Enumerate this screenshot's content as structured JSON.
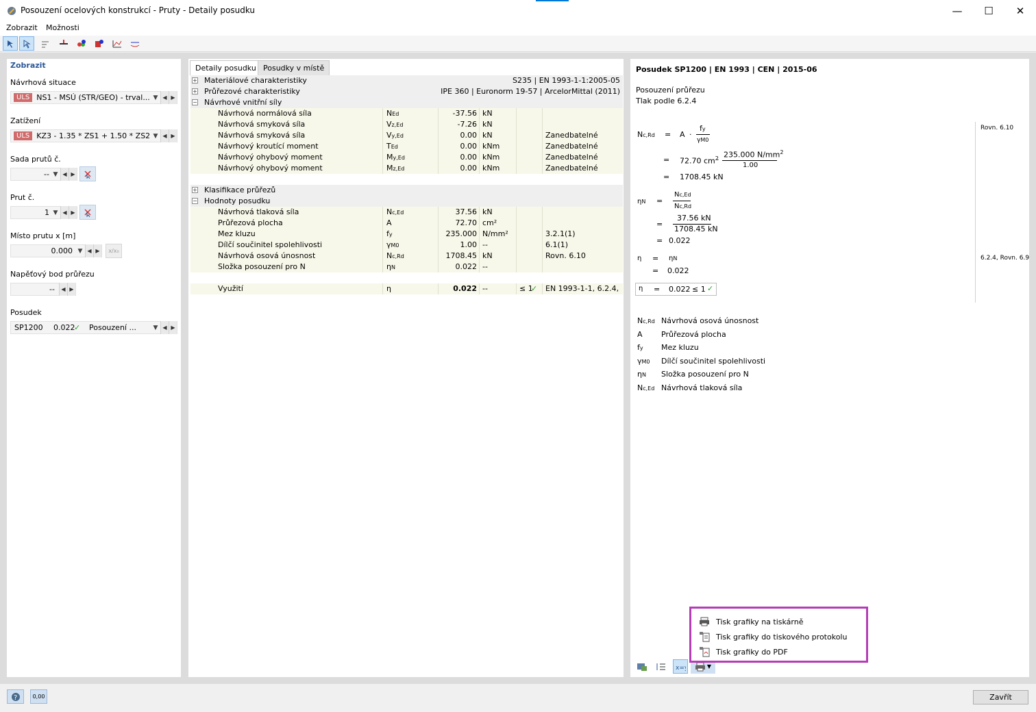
{
  "window": {
    "title": "Posouzení ocelových konstrukcí - Pruty - Detaily posudku",
    "minimize": "—",
    "maximize": "☐",
    "close": "✕"
  },
  "menu": [
    "Zobrazit",
    "Možnosti"
  ],
  "left": {
    "header": "Zobrazit",
    "design_situation_label": "Návrhová situace",
    "design_situation_tag": "ULS",
    "design_situation_value": "NS1 - MSÚ (STR/GEO) - trval...",
    "loading_label": "Zatížení",
    "loading_tag": "ULS",
    "loading_value": "KZ3 - 1.35 * ZS1 + 1.50 * ZS2 ...",
    "member_set_label": "Sada prutů č.",
    "member_set_value": "--",
    "member_label": "Prut č.",
    "member_value": "1",
    "location_label": "Místo prutu x [m]",
    "location_value": "0.000",
    "location_btn": "x/x₀",
    "stress_point_label": "Napěťový bod průřezu",
    "stress_point_value": "--",
    "check_label": "Posudek",
    "check_id": "SP1200",
    "check_ratio": "0.022",
    "check_desc": "Posouzení ..."
  },
  "tabs": [
    "Detaily posudku",
    "Posudky v místě"
  ],
  "table": {
    "groups": {
      "material": {
        "label": "Materiálové charakteristiky",
        "value": "S235 | EN 1993-1-1:2005-05"
      },
      "section": {
        "label": "Průřezové charakteristiky",
        "value": "IPE 360 | Euronorm 19-57 | ArcelorMittal (2011)"
      },
      "forces": {
        "label": "Návrhové vnitřní síly"
      },
      "classification": {
        "label": "Klasifikace průřezů"
      },
      "check_values": {
        "label": "Hodnoty posudku"
      }
    },
    "force_rows": [
      {
        "name": "Návrhová normálová síla",
        "sym": "N",
        "sub": "Ed",
        "val": "-37.56",
        "unit": "kN",
        "note": ""
      },
      {
        "name": "Návrhová smyková síla",
        "sym": "V",
        "sub": "z,Ed",
        "val": "-7.26",
        "unit": "kN",
        "note": ""
      },
      {
        "name": "Návrhová smyková síla",
        "sym": "V",
        "sub": "y,Ed",
        "val": "0.00",
        "unit": "kN",
        "note": "Zanedbatelné"
      },
      {
        "name": "Návrhový kroutící moment",
        "sym": "T",
        "sub": "Ed",
        "val": "0.00",
        "unit": "kNm",
        "note": "Zanedbatelné"
      },
      {
        "name": "Návrhový ohybový moment",
        "sym": "M",
        "sub": "y,Ed",
        "val": "0.00",
        "unit": "kNm",
        "note": "Zanedbatelné"
      },
      {
        "name": "Návrhový ohybový moment",
        "sym": "M",
        "sub": "z,Ed",
        "val": "0.00",
        "unit": "kNm",
        "note": "Zanedbatelné"
      }
    ],
    "check_rows": [
      {
        "name": "Návrhová tlaková síla",
        "sym": "N",
        "sub": "c,Ed",
        "val": "37.56",
        "unit": "kN",
        "note": ""
      },
      {
        "name": "Průřezová plocha",
        "sym": "A",
        "sub": "",
        "val": "72.70",
        "unit": "cm²",
        "note": ""
      },
      {
        "name": "Mez kluzu",
        "sym": "f",
        "sub": "y",
        "val": "235.000",
        "unit": "N/mm²",
        "note": "3.2.1(1)"
      },
      {
        "name": "Dílčí součinitel spolehlivosti",
        "sym": "γ",
        "sub": "M0",
        "val": "1.00",
        "unit": "--",
        "note": "6.1(1)"
      },
      {
        "name": "Návrhová osová únosnost",
        "sym": "N",
        "sub": "c,Rd",
        "val": "1708.45",
        "unit": "kN",
        "note": "Rovn. 6.10"
      },
      {
        "name": "Složka posouzení pro N",
        "sym": "η",
        "sub": "N",
        "val": "0.022",
        "unit": "--",
        "note": ""
      }
    ],
    "utilization": {
      "name": "Využití",
      "sym": "η",
      "val": "0.022",
      "unit": "--",
      "limit": "≤ 1",
      "note": "EN 1993-1-1, 6.2.4,"
    }
  },
  "right": {
    "title": "Posudek SP1200 | EN 1993 | CEN | 2015-06",
    "subtitle1": "Posouzení průřezu",
    "subtitle2": "Tlak podle 6.2.4",
    "ref1": "Rovn. 6.10",
    "ref2": "6.2.4, Rovn. 6.9",
    "f_a_val": "72.70 cm",
    "f_fy_val": "235.000 N/mm",
    "f_gamma_val": "1.00",
    "f_ncrd_val": "1708.45 kN",
    "f_ned_val": "37.56 kN",
    "f_eta_val": "0.022",
    "f_eta_box": "0.022",
    "f_le1": "≤ 1",
    "legend": [
      {
        "sym": "N",
        "sub": "c,Rd",
        "desc": "Návrhová osová únosnost"
      },
      {
        "sym": "A",
        "sub": "",
        "desc": "Průřezová plocha"
      },
      {
        "sym": "f",
        "sub": "y",
        "desc": "Mez kluzu"
      },
      {
        "sym": "γ",
        "sub": "M0",
        "desc": "Dílčí součinitel spolehlivosti"
      },
      {
        "sym": "η",
        "sub": "N",
        "desc": "Složka posouzení pro N"
      },
      {
        "sym": "N",
        "sub": "c,Ed",
        "desc": "Návrhová tlaková síla"
      }
    ]
  },
  "popup": {
    "item1": "Tisk grafiky na tiskárně",
    "item2": "Tisk grafiky do tiskového protokolu",
    "item3": "Tisk grafiky do PDF"
  },
  "status": {
    "decimals_btn": "0,00"
  },
  "footer": {
    "close_button": "Zavřít"
  },
  "colors": {
    "accent": "#2b5797",
    "uls_tag": "#cf6b6b",
    "check_green": "#2e9e2e",
    "highlight": "#b43db6",
    "row_bg": "#f8f8ea"
  }
}
